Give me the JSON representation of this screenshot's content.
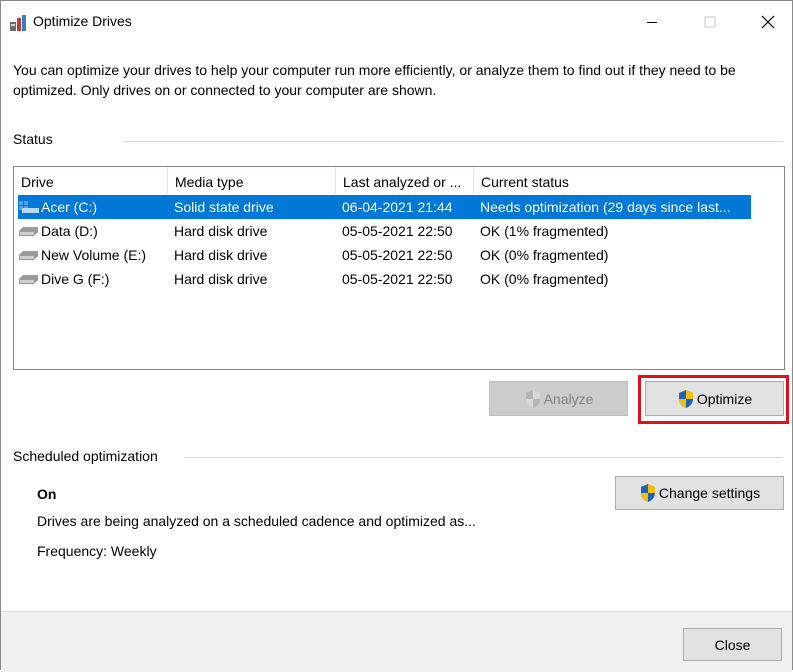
{
  "window": {
    "title": "Optimize Drives",
    "icon": "optimize-drives-app-icon",
    "controls": [
      "minimize-icon",
      "maximize-icon",
      "close-icon"
    ]
  },
  "intro_text": "You can optimize your drives to help your computer run more efficiently, or analyze them to find out if they need to be optimized. Only drives on or connected to your computer are shown.",
  "status": {
    "label": "Status",
    "columns": [
      "Drive",
      "Media type",
      "Last analyzed or ...",
      "Current status"
    ],
    "rows": [
      {
        "drive": "Acer (C:)",
        "media": "Solid state drive",
        "last": "06-04-2021 21:44",
        "status": "Needs optimization (29 days since last...",
        "selected": true,
        "icon": "ssd-drive-icon"
      },
      {
        "drive": "Data (D:)",
        "media": "Hard disk drive",
        "last": "05-05-2021 22:50",
        "status": "OK (1% fragmented)",
        "selected": false,
        "icon": "hard-disk-icon"
      },
      {
        "drive": "New Volume (E:)",
        "media": "Hard disk drive",
        "last": "05-05-2021 22:50",
        "status": "OK (0% fragmented)",
        "selected": false,
        "icon": "hard-disk-icon"
      },
      {
        "drive": "Dive G (F:)",
        "media": "Hard disk drive",
        "last": "05-05-2021 22:50",
        "status": "OK (0% fragmented)",
        "selected": false,
        "icon": "hard-disk-icon"
      }
    ]
  },
  "buttons": {
    "analyze": "Analyze",
    "optimize": "Optimize",
    "change_settings": "Change settings",
    "close": "Close"
  },
  "scheduled": {
    "label": "Scheduled optimization",
    "state": "On",
    "description": "Drives are being analyzed on a scheduled cadence and optimized as...",
    "frequency": "Frequency: Weekly"
  },
  "colors": {
    "selection": "#0078d7",
    "highlight_box": "#e0101e",
    "footer": "#f0f0f0",
    "button": "#e1e1e1",
    "button_disabled": "#cccccc"
  }
}
